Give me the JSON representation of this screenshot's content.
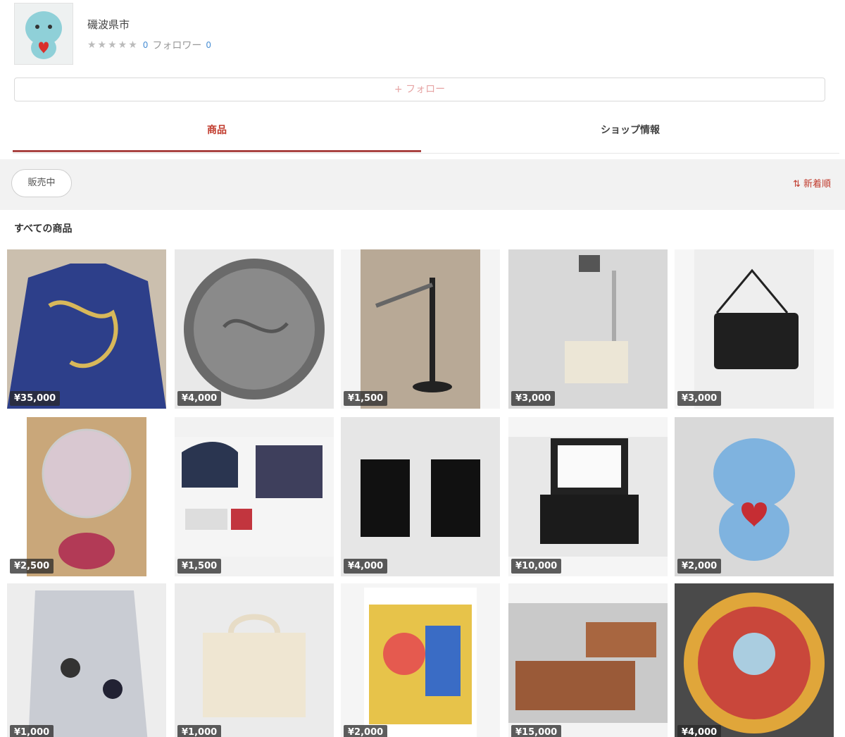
{
  "profile": {
    "shop_name": "磯波県市",
    "stars": "★★★★★",
    "rating_count": "0",
    "follower_label": "フォロワー",
    "follower_count": "0"
  },
  "follow_button": {
    "label": "+ フォロー"
  },
  "tabs": [
    {
      "label": "商品",
      "active": true
    },
    {
      "label": "ショップ情報",
      "active": false
    }
  ],
  "filter": {
    "pill_label": "販売中",
    "sort_label": "⇅ 新着順"
  },
  "section_title": "すべての商品",
  "colors": {
    "accent": "#c0392b",
    "tab_underline": "#a94442"
  },
  "products": [
    {
      "price": "¥35,000",
      "icon": "jacket-icon"
    },
    {
      "price": "¥4,000",
      "icon": "manhole-cover-icon"
    },
    {
      "price": "¥1,500",
      "icon": "lamp-icon"
    },
    {
      "price": "¥3,000",
      "icon": "projector-icon"
    },
    {
      "price": "¥3,000",
      "icon": "camera-icon"
    },
    {
      "price": "¥2,500",
      "icon": "fan-icon"
    },
    {
      "price": "¥1,500",
      "icon": "cassette-player-icon"
    },
    {
      "price": "¥4,000",
      "icon": "speaker-icon"
    },
    {
      "price": "¥10,000",
      "icon": "printer-icon"
    },
    {
      "price": "¥2,000",
      "icon": "plush-toy-icon"
    },
    {
      "price": "¥1,000",
      "icon": "keychain-icon"
    },
    {
      "price": "¥1,000",
      "icon": "tote-bag-icon"
    },
    {
      "price": "¥2,000",
      "icon": "poster-icon"
    },
    {
      "price": "¥15,000",
      "icon": "sofa-icon"
    },
    {
      "price": "¥4,000",
      "icon": "manhole-cover-icon"
    }
  ]
}
